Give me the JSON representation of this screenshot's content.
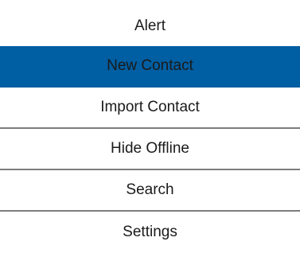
{
  "menu": {
    "items": [
      {
        "label": "Alert"
      },
      {
        "label": "New Contact",
        "selected": true
      },
      {
        "label": "Import Contact"
      },
      {
        "label": "Hide Offline"
      },
      {
        "label": "Search"
      },
      {
        "label": "Settings"
      }
    ],
    "colors": {
      "selected_background": "#005ea2",
      "text": "#1a1a1a",
      "divider": "#7d7d7d",
      "background": "#ffffff"
    }
  }
}
